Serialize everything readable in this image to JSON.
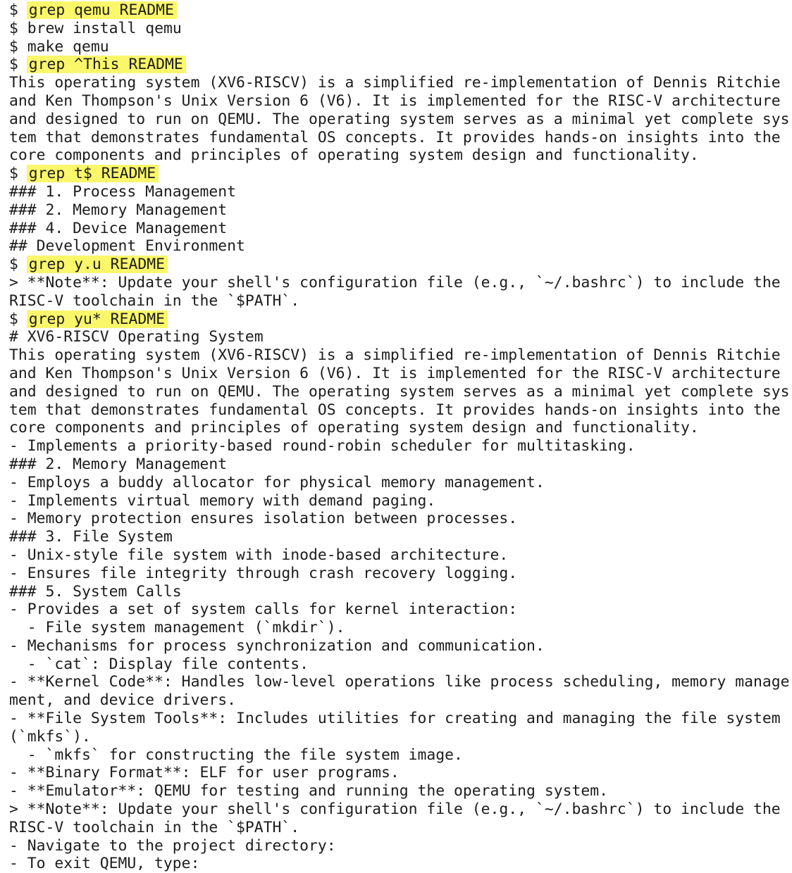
{
  "terminal": {
    "prompt_symbol": "$",
    "lines": [
      {
        "type": "cmd",
        "text": "grep qemu README"
      },
      {
        "type": "cmd_plain",
        "text": "brew install qemu"
      },
      {
        "type": "cmd_plain",
        "text": "make qemu"
      },
      {
        "type": "cmd",
        "text": "grep ^This README"
      },
      {
        "type": "out",
        "text": "This operating system (XV6-RISCV) is a simplified re-implementation of Dennis Ritchie"
      },
      {
        "type": "out",
        "text": "and Ken Thompson's Unix Version 6 (V6). It is implemented for the RISC-V architecture"
      },
      {
        "type": "out",
        "text": "and designed to run on QEMU. The operating system serves as a minimal yet complete sys"
      },
      {
        "type": "out",
        "text": "tem that demonstrates fundamental OS concepts. It provides hands-on insights into the"
      },
      {
        "type": "out",
        "text": "core components and principles of operating system design and functionality."
      },
      {
        "type": "cmd",
        "text": "grep t$ README"
      },
      {
        "type": "out",
        "text": "### 1. Process Management"
      },
      {
        "type": "out",
        "text": "### 2. Memory Management"
      },
      {
        "type": "out",
        "text": "### 4. Device Management"
      },
      {
        "type": "out",
        "text": "## Development Environment"
      },
      {
        "type": "cmd",
        "text": "grep y.u README"
      },
      {
        "type": "out",
        "text": "> **Note**: Update your shell's configuration file (e.g., `~/.bashrc`) to include the"
      },
      {
        "type": "out",
        "text": "RISC-V toolchain in the `$PATH`."
      },
      {
        "type": "cmd",
        "text": "grep yu* README"
      },
      {
        "type": "out",
        "text": "# XV6-RISCV Operating System"
      },
      {
        "type": "out",
        "text": "This operating system (XV6-RISCV) is a simplified re-implementation of Dennis Ritchie"
      },
      {
        "type": "out",
        "text": "and Ken Thompson's Unix Version 6 (V6). It is implemented for the RISC-V architecture"
      },
      {
        "type": "out",
        "text": "and designed to run on QEMU. The operating system serves as a minimal yet complete sys"
      },
      {
        "type": "out",
        "text": "tem that demonstrates fundamental OS concepts. It provides hands-on insights into the"
      },
      {
        "type": "out",
        "text": "core components and principles of operating system design and functionality."
      },
      {
        "type": "out",
        "text": "- Implements a priority-based round-robin scheduler for multitasking."
      },
      {
        "type": "out",
        "text": "### 2. Memory Management"
      },
      {
        "type": "out",
        "text": "- Employs a buddy allocator for physical memory management."
      },
      {
        "type": "out",
        "text": "- Implements virtual memory with demand paging."
      },
      {
        "type": "out",
        "text": "- Memory protection ensures isolation between processes."
      },
      {
        "type": "out",
        "text": "### 3. File System"
      },
      {
        "type": "out",
        "text": "- Unix-style file system with inode-based architecture."
      },
      {
        "type": "out",
        "text": "- Ensures file integrity through crash recovery logging."
      },
      {
        "type": "out",
        "text": "### 5. System Calls"
      },
      {
        "type": "out",
        "text": "- Provides a set of system calls for kernel interaction:"
      },
      {
        "type": "out",
        "text": "  - File system management (`mkdir`)."
      },
      {
        "type": "out",
        "text": "- Mechanisms for process synchronization and communication."
      },
      {
        "type": "out",
        "text": "  - `cat`: Display file contents."
      },
      {
        "type": "out",
        "text": "- **Kernel Code**: Handles low-level operations like process scheduling, memory manage"
      },
      {
        "type": "out",
        "text": "ment, and device drivers."
      },
      {
        "type": "out",
        "text": "- **File System Tools**: Includes utilities for creating and managing the file system"
      },
      {
        "type": "out",
        "text": "(`mkfs`)."
      },
      {
        "type": "out",
        "text": "  - `mkfs` for constructing the file system image."
      },
      {
        "type": "out",
        "text": "- **Binary Format**: ELF for user programs."
      },
      {
        "type": "out",
        "text": "- **Emulator**: QEMU for testing and running the operating system."
      },
      {
        "type": "out",
        "text": "> **Note**: Update your shell's configuration file (e.g., `~/.bashrc`) to include the"
      },
      {
        "type": "out",
        "text": "RISC-V toolchain in the `$PATH`."
      },
      {
        "type": "out",
        "text": "- Navigate to the project directory:"
      },
      {
        "type": "out",
        "text": "- To exit QEMU, type:"
      }
    ]
  },
  "colors": {
    "highlight": "#fbf76a",
    "text": "#1c1c1c",
    "background": "#ffffff"
  }
}
